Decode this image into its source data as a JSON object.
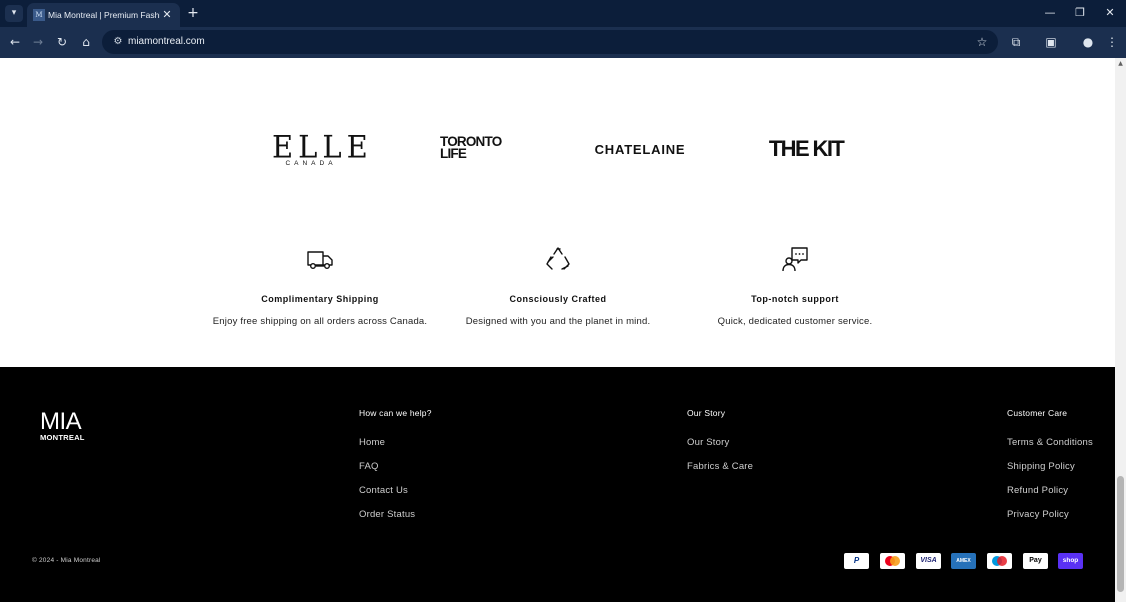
{
  "browser": {
    "tab_title": "Mia Montreal | Premium Fashion",
    "tab_favicon": "favicon",
    "url": "miamontreal.com",
    "icons": [
      "tab-list-icon",
      "close-icon",
      "new-tab-icon",
      "minimize-icon",
      "restore-icon",
      "close-window-icon",
      "back-icon",
      "forward-icon",
      "reload-icon",
      "home-icon",
      "site-info-icon",
      "bookmark-star-icon",
      "extensions-icon",
      "media-icon",
      "profile-icon",
      "menu-icon"
    ]
  },
  "press": {
    "elle_big": "ELLE",
    "elle_small": "CANADA",
    "toronto_line1": "TORONTO",
    "toronto_line2": "LIFE",
    "chatelaine": "CHATELAINE",
    "thekit": "THE KIT"
  },
  "features": [
    {
      "icon": "truck-icon",
      "title": "Complimentary Shipping",
      "text": "Enjoy free shipping on all orders across Canada."
    },
    {
      "icon": "recycle-icon",
      "title": "Consciously Crafted",
      "text": "Designed with you and the planet in mind."
    },
    {
      "icon": "support-chat-icon",
      "title": "Top-notch support",
      "text": "Quick, dedicated customer service."
    }
  ],
  "footer": {
    "brand_top": "MIA",
    "brand_bottom": "MONTREAL",
    "columns": [
      {
        "heading": "How can we help?",
        "links": [
          "Home",
          "FAQ",
          "Contact Us",
          "Order Status"
        ]
      },
      {
        "heading": "Our Story",
        "links": [
          "Our Story",
          "Fabrics & Care"
        ]
      },
      {
        "heading": "Customer Care",
        "links": [
          "Terms & Conditions",
          "Shipping Policy",
          "Refund Policy",
          "Privacy Policy"
        ]
      }
    ],
    "copyright": "© 2024 - Mia Montreal",
    "payments": [
      {
        "name": "paypal-icon",
        "label": "P",
        "color": "#003087"
      },
      {
        "name": "mastercard-icon",
        "label": "",
        "color": "#eb001b"
      },
      {
        "name": "visa-icon",
        "label": "VISA",
        "color": "#1a1f71"
      },
      {
        "name": "amex-icon",
        "label": "AMEX",
        "color": "#ffffff"
      },
      {
        "name": "maestro-icon",
        "label": "",
        "color": "#0099df"
      },
      {
        "name": "apple-pay-icon",
        "label": "Pay",
        "color": "#000000"
      },
      {
        "name": "shop-pay-icon",
        "label": "shop",
        "color": "#ffffff"
      }
    ]
  },
  "colors": {
    "chrome_dark": "#0c1e3a",
    "chrome_toolbar": "#1b2f4f",
    "footer_bg": "#000000",
    "amex_blue": "#2671b9",
    "shop_purple": "#5a31f4"
  }
}
